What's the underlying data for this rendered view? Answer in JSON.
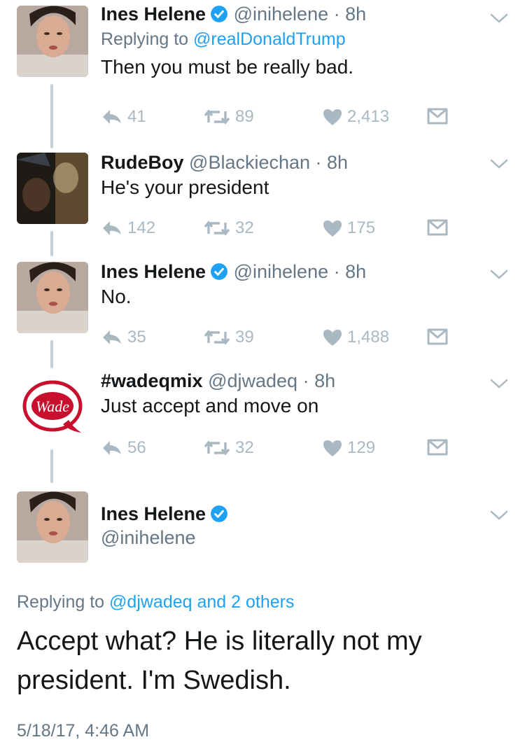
{
  "colors": {
    "text": "#14171a",
    "muted": "#657786",
    "link": "#1da1f2",
    "icon": "#aab8c2",
    "verified": "#1da1f2"
  },
  "icons": [
    "reply-icon",
    "retweet-icon",
    "like-icon",
    "dm-icon",
    "verified-badge-icon",
    "chevron-down-icon"
  ],
  "tweets": [
    {
      "name": "Ines Helene",
      "verified": true,
      "handle": "@inihelene",
      "time": "8h",
      "replying_label": "Replying to",
      "replying_to": "@realDonaldTrump",
      "text": "Then you must be really bad.",
      "replies": "41",
      "retweets": "89",
      "likes": "2,413"
    },
    {
      "name": "RudeBoy",
      "verified": false,
      "handle": "@Blackiechan",
      "time": "8h",
      "text": "He's your president",
      "replies": "142",
      "retweets": "32",
      "likes": "175"
    },
    {
      "name": "Ines Helene",
      "verified": true,
      "handle": "@inihelene",
      "time": "8h",
      "text": "No.",
      "replies": "35",
      "retweets": "39",
      "likes": "1,488"
    },
    {
      "name": "#wadeqmix",
      "verified": false,
      "handle": "@djwadeq",
      "time": "8h",
      "text": "Just accept and move on",
      "replies": "56",
      "retweets": "32",
      "likes": "129",
      "avatar_text": "Wade"
    }
  ],
  "main_tweet": {
    "name": "Ines Helene",
    "verified": true,
    "handle": "@inihelene",
    "replying_label": "Replying to",
    "replying_to": "@djwadeq and 2 others",
    "text_line1": "Accept what? He is literally not my",
    "text_line2": "president. I'm Swedish.",
    "timestamp": "5/18/17, 4:46 AM"
  }
}
